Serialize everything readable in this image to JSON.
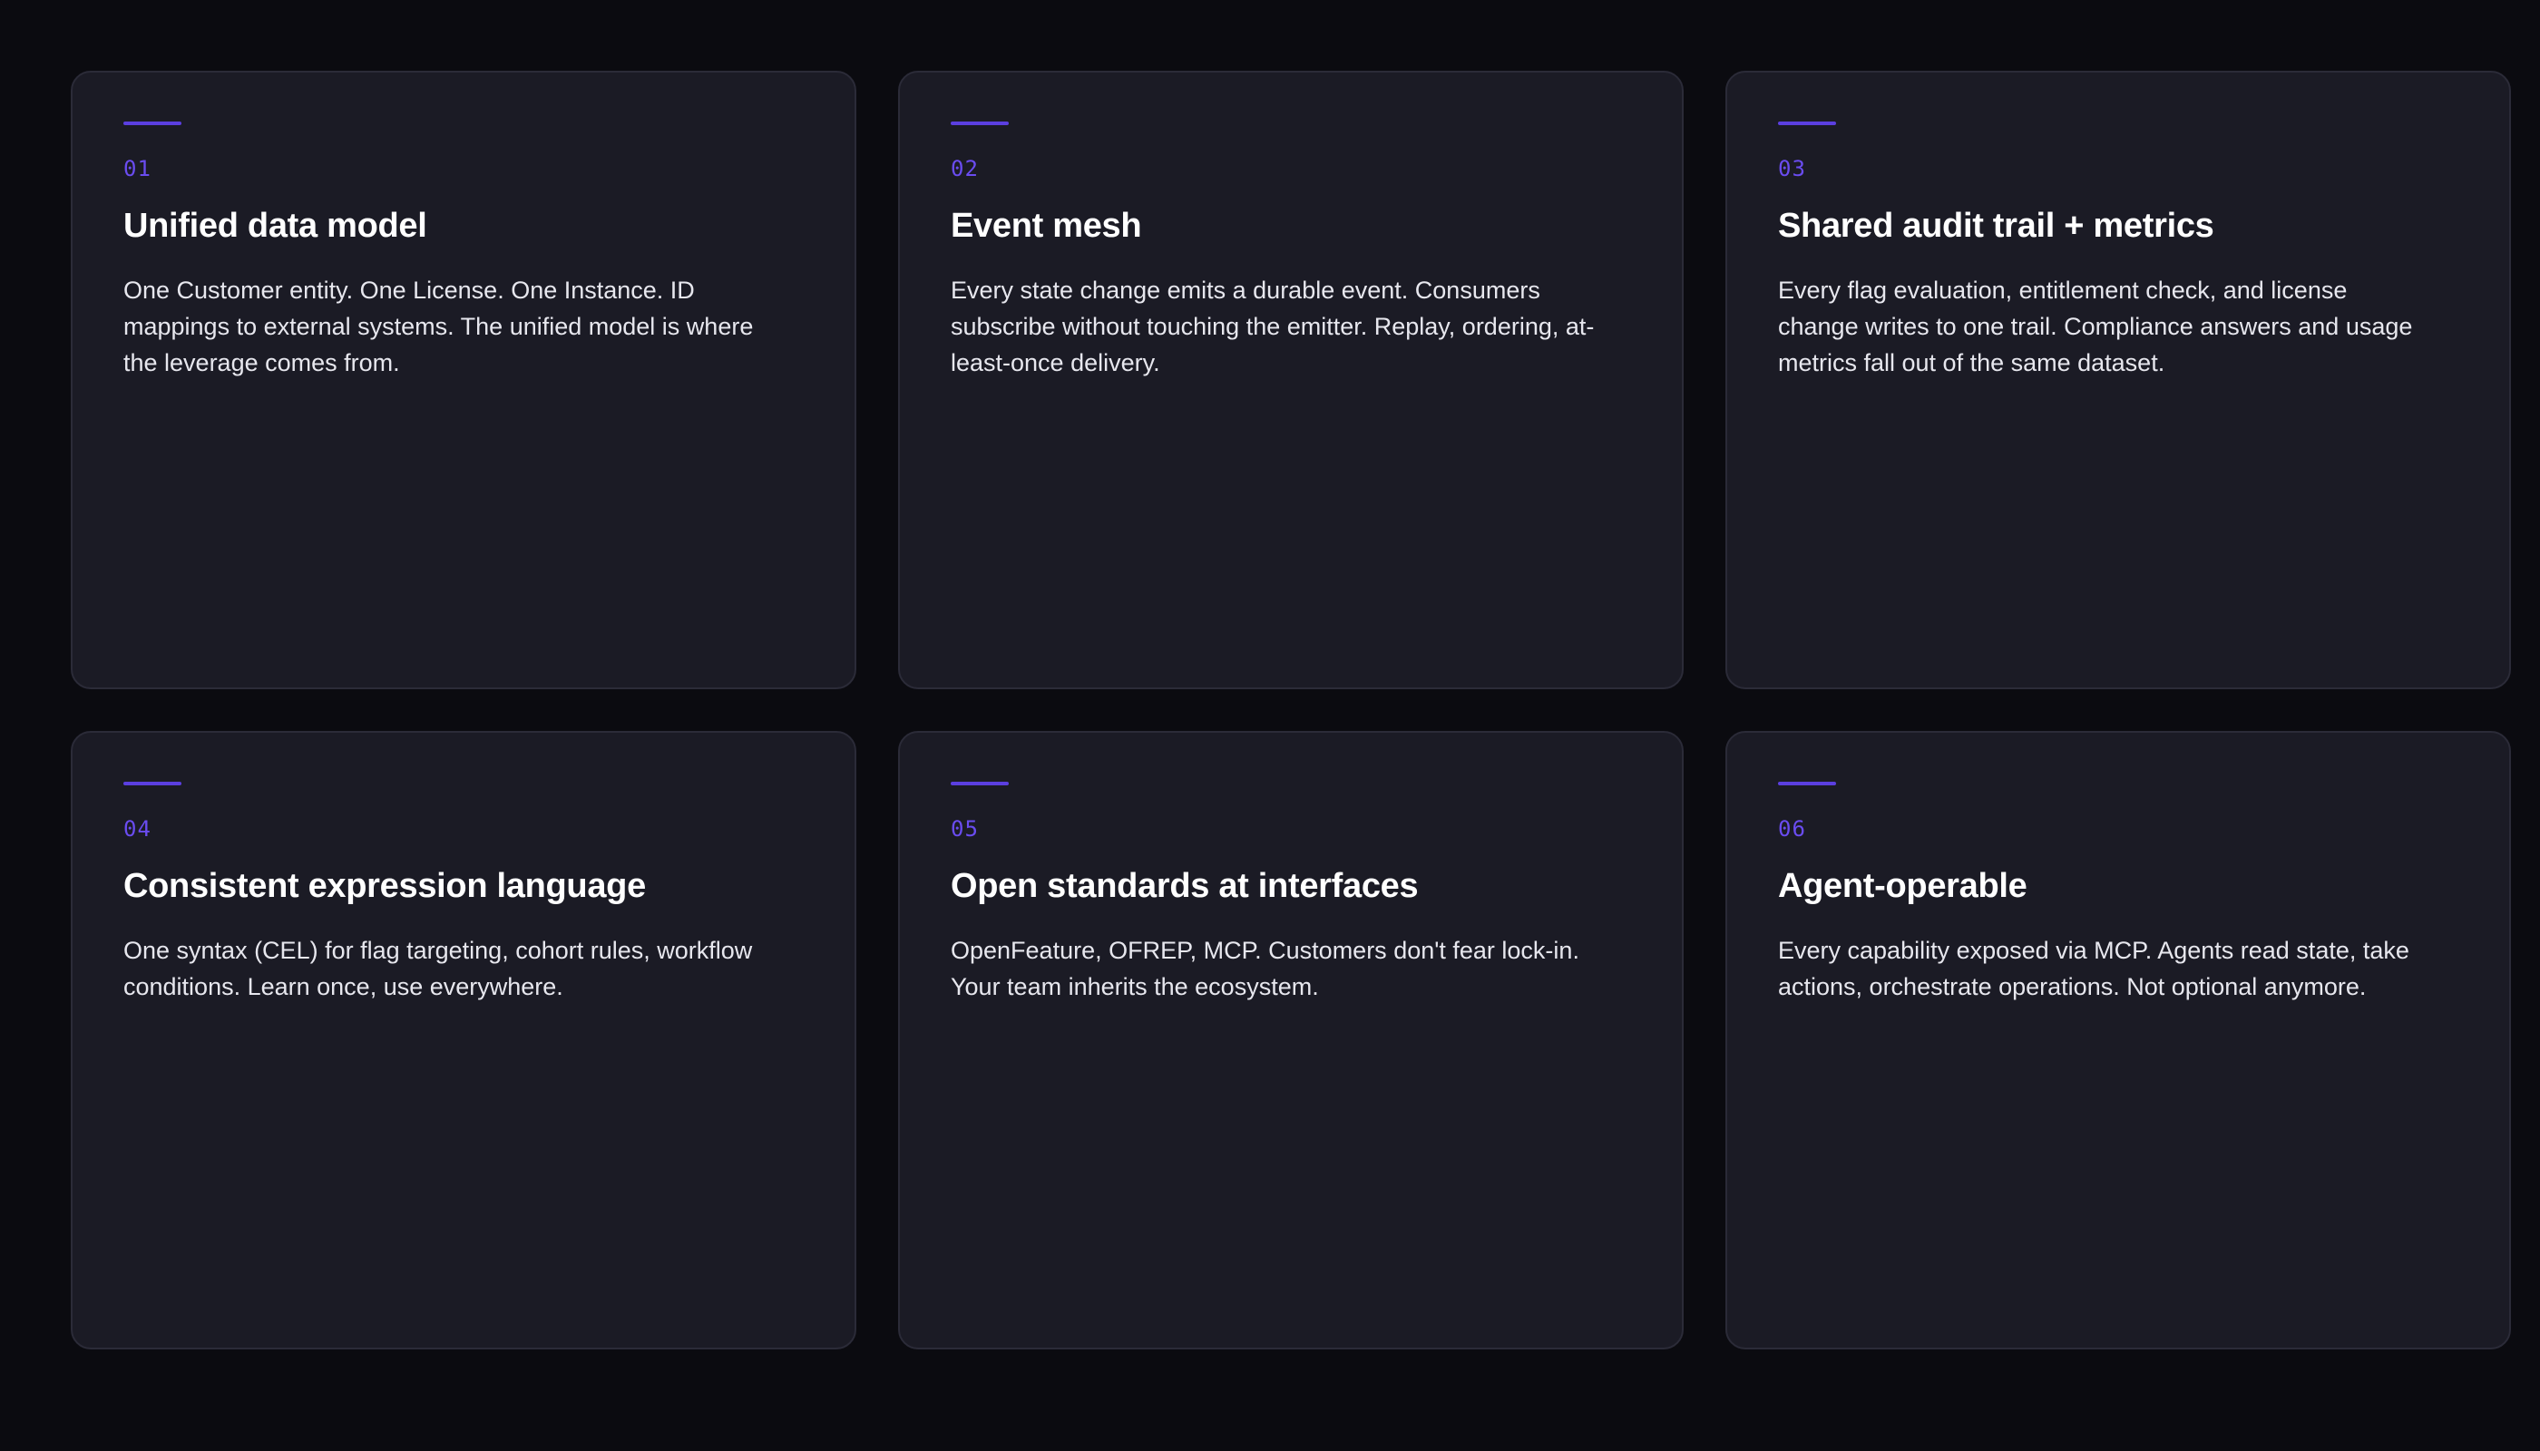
{
  "colors": {
    "page_background": "#0b0b10",
    "card_background": "#1b1b25",
    "card_border": "#2b2b38",
    "accent": "#5b3fe0",
    "number_text": "#6a4cf0",
    "title_text": "#ffffff",
    "body_text": "#e7e7ee"
  },
  "cards": [
    {
      "number": "01",
      "title": "Unified data model",
      "body": "One Customer entity. One License. One Instance. ID mappings to external systems. The unified model is where the leverage comes from."
    },
    {
      "number": "02",
      "title": "Event mesh",
      "body": "Every state change emits a durable event. Consumers subscribe without touching the emitter. Replay, ordering, at-least-once delivery."
    },
    {
      "number": "03",
      "title": "Shared audit trail + metrics",
      "body": "Every flag evaluation, entitlement check, and license change writes to one trail. Compliance answers and usage metrics fall out of the same dataset."
    },
    {
      "number": "04",
      "title": "Consistent expression language",
      "body": "One syntax (CEL) for flag targeting, cohort rules, workflow conditions. Learn once, use everywhere."
    },
    {
      "number": "05",
      "title": "Open standards at interfaces",
      "body": "OpenFeature, OFREP, MCP. Customers don't fear lock-in. Your team inherits the ecosystem."
    },
    {
      "number": "06",
      "title": "Agent-operable",
      "body": "Every capability exposed via MCP. Agents read state, take actions, orchestrate operations. Not optional anymore."
    }
  ]
}
